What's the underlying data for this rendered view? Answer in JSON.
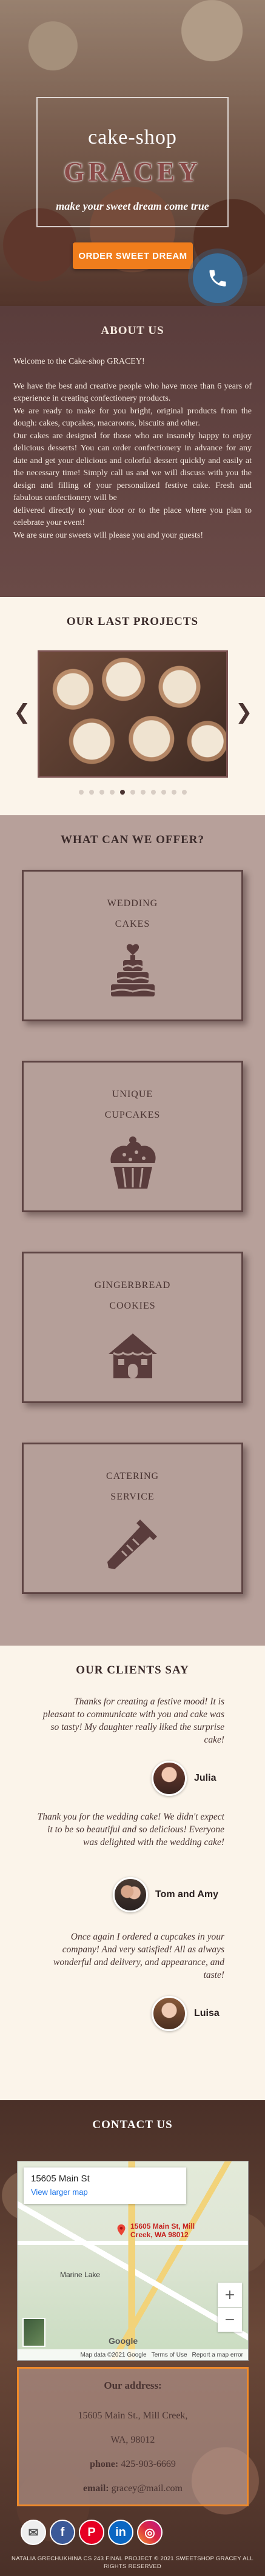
{
  "hero": {
    "title_top": "cake-shop",
    "title_main": "GRACEY",
    "tagline": "make your sweet dream come true",
    "order_button": "ORDER SWEET DREAM"
  },
  "about": {
    "title": "ABOUT US",
    "paragraphs": [
      "Welcome to the Cake-shop GRACEY!",
      "We have the best and creative people who have more than 6 years of experience in creating confectionery products.",
      "We are ready to make for you bright, original products from the dough: cakes, cupcakes, macaroons, biscuits and other.",
      "Our cakes are designed for those who are insanely happy to enjoy delicious desserts! You can order confectionery in advance for any date and get your delicious and colorful dessert quickly and easily at the necessary time! Simply call us and we will discuss with you the design and filling of your personalized festive cake. Fresh and fabulous confectionery will be",
      "delivered directly to your door or to the place where you plan to celebrate your event!",
      "We are sure our sweets will please you and your guests!"
    ]
  },
  "projects": {
    "title": "OUR LAST PROJECTS",
    "prev": "❮",
    "next": "❯",
    "slide_count": 11,
    "active_index": 4
  },
  "offer": {
    "title": "WHAT CAN WE OFFER?",
    "cards": [
      {
        "line1": "WEDDING",
        "line2": "CAKES",
        "icon": "wedding-cake-icon"
      },
      {
        "line1": "UNIQUE",
        "line2": "CUPCAKES",
        "icon": "cupcake-icon"
      },
      {
        "line1": "GINGERBREAD",
        "line2": "COOKIES",
        "icon": "gingerbread-house-icon"
      },
      {
        "line1": "CATERING",
        "line2": "SERVICE",
        "icon": "piping-bag-icon"
      }
    ]
  },
  "clients": {
    "title": "OUR CLIENTS SAY",
    "reviews": [
      {
        "text": "Thanks for creating a festive mood! It is pleasant to communicate with you and cake was so tasty! My daughter really liked the surprise cake!",
        "author": "Julia"
      },
      {
        "text": "Thank you for the wedding cake! We didn't expect it to be so beautiful and so delicious! Everyone was delighted with the wedding cake!",
        "author": "Tom and Amy"
      },
      {
        "text": "Once again I ordered a cupcakes in your company! And very satisfied! All as always wonderful and delivery, and appearance, and taste!",
        "author": "Luisa"
      }
    ]
  },
  "contact": {
    "title": "CONTACT US",
    "map": {
      "place_title": "15605 Main St",
      "larger_map": "View larger map",
      "pin_label": "15605 Main St, Mill Creek, WA 98012",
      "town": "Marine Lake",
      "google": "Google",
      "footer_data": "Map data ©2021 Google",
      "footer_terms": "Terms of Use",
      "footer_report": "Report a map error",
      "zoom_in": "+",
      "zoom_out": "−"
    },
    "address": {
      "title": "Our address:",
      "line1": "15605 Main St., Mill Creek,",
      "line2": "WA, 98012",
      "phone_label": "phone:",
      "phone": "425-903-6669",
      "email_label": "email:",
      "email": "gracey@mail.com"
    },
    "socials": {
      "fb": "f",
      "pin": "P",
      "li": "in",
      "ig": "◎",
      "email": "✉"
    },
    "copyright": "NATALIA GRECHUKHINA CS 243 FINAL PROJECT © 2021 SWEETSHOP GRACEY ALL RIGHTS RESERVED"
  },
  "colors": {
    "accent": "#f07d1c",
    "phone_fab": "#3a6d98",
    "about_bg": "#5a3d3c",
    "offer_bg": "#b7a09a",
    "card_border": "#5e4443"
  }
}
